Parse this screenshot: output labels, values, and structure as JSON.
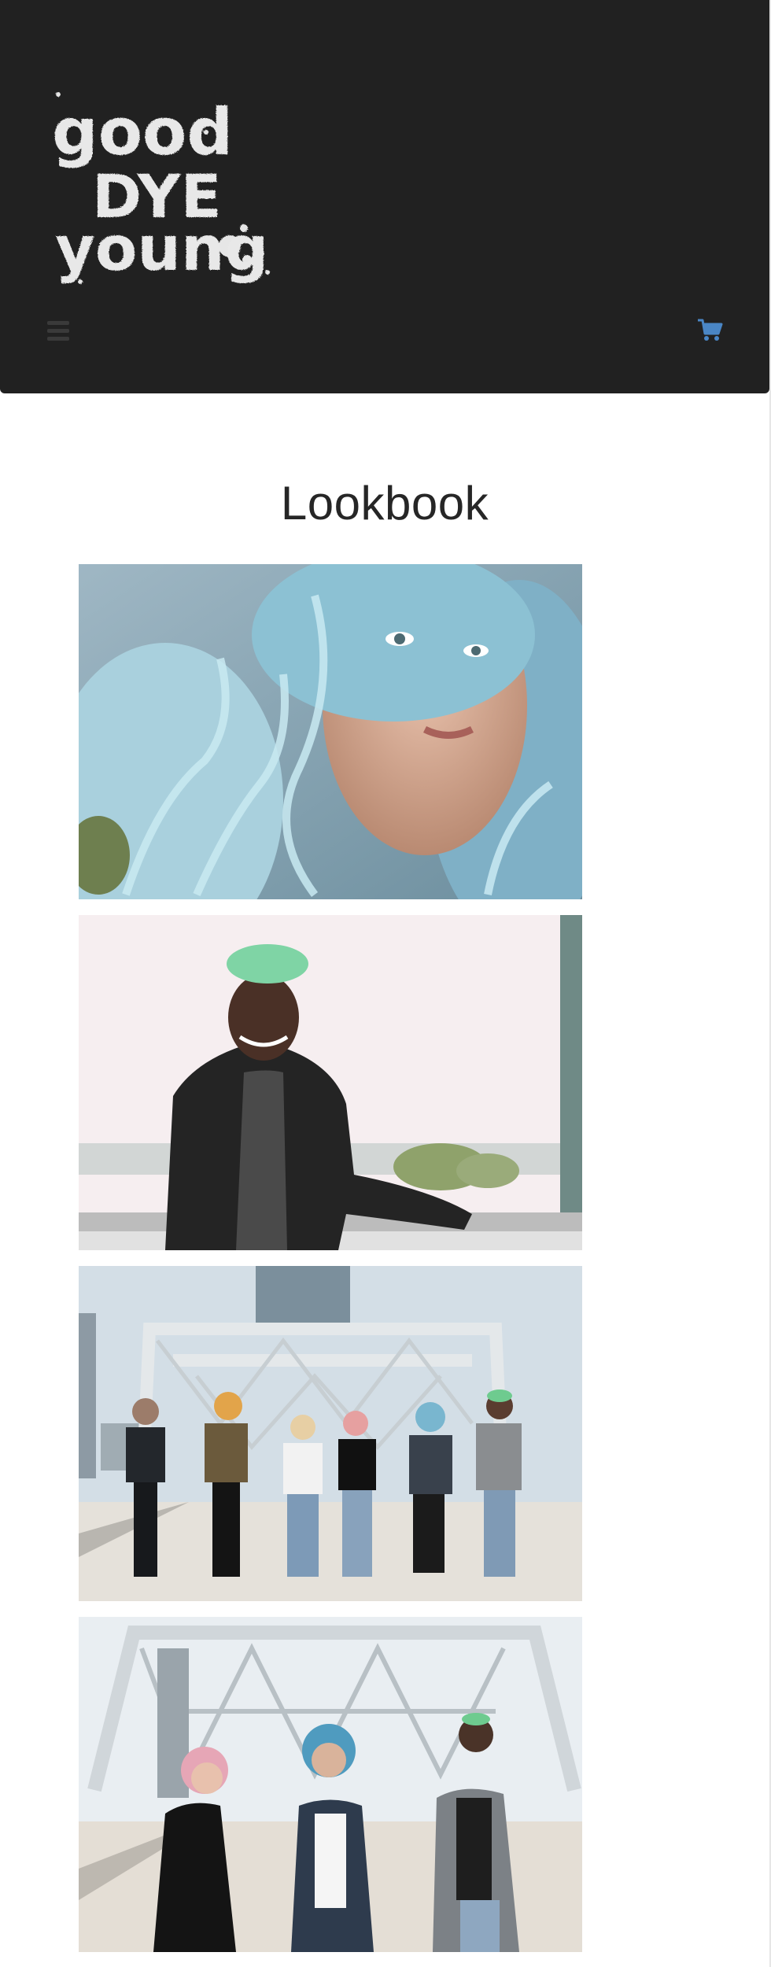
{
  "header": {
    "logo_text": [
      "good",
      "DYE",
      "young"
    ],
    "logo_icon": "good-dye-young-logo",
    "menu_icon": "hamburger-menu-icon",
    "cart_icon": "shopping-cart-icon",
    "cart_color": "#4a86c5",
    "background": "#212121"
  },
  "page": {
    "title": "Lookbook"
  },
  "lookbook": {
    "photos": [
      {
        "subject": "portrait-blue-curly-hair"
      },
      {
        "subject": "man-green-hair-leather-jacket"
      },
      {
        "subject": "group-walking-on-bridge"
      },
      {
        "subject": "three-friends-walking-on-bridge"
      }
    ]
  }
}
